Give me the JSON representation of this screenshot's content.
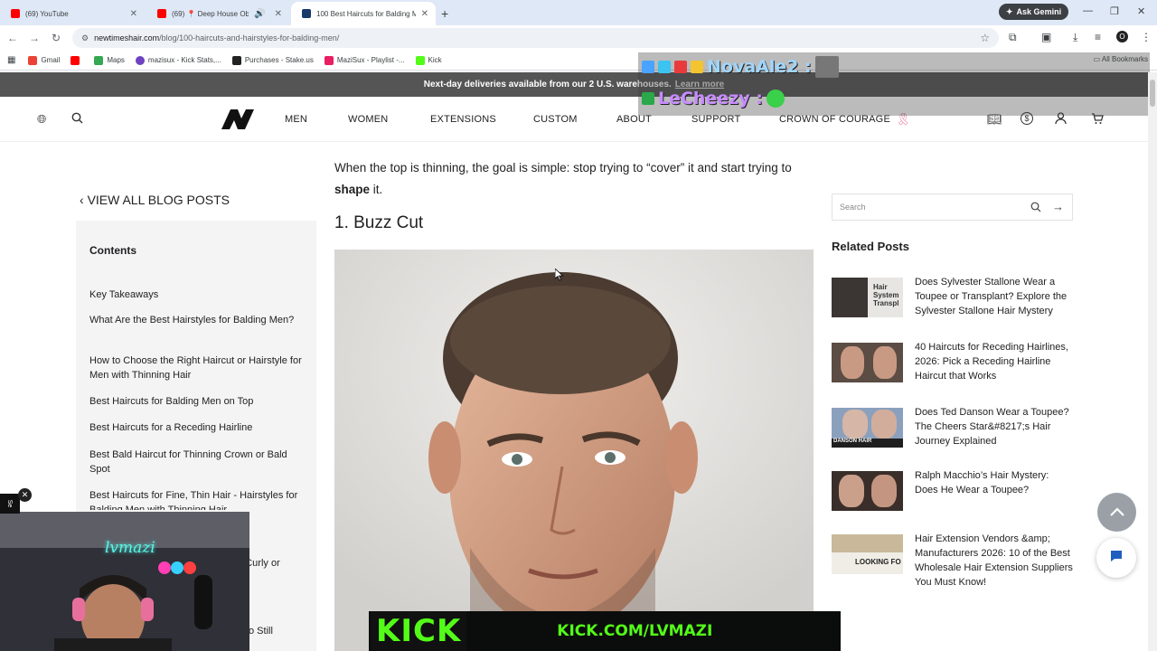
{
  "browser": {
    "tabs": [
      {
        "title": "(69) YouTube",
        "color": "#ff0000"
      },
      {
        "title": "(69) 📍 Deep House Obse",
        "color": "#ff0000"
      },
      {
        "title": "100 Best Haircuts for Balding M",
        "color": "#1a3a6b"
      }
    ],
    "new_tab": "+",
    "gemini_label": "Ask Gemini",
    "url_host": "newtimeshair.com",
    "url_path": "/blog/100-haircuts-and-hairstyles-for-balding-men/",
    "bookmarks": [
      {
        "label": "Gmail",
        "color": "#ea4335"
      },
      {
        "label": "Maps",
        "color": "#34a853"
      },
      {
        "label": "mazisux - Kick Stats,...",
        "color": "#6f42c1"
      },
      {
        "label": "Purchases - Stake.us",
        "color": "#222222"
      },
      {
        "label": "MaziSux - Playlist -...",
        "color": "#e91e63"
      },
      {
        "label": "Kick",
        "color": "#53fc18"
      }
    ],
    "all_bookmarks": "All Bookmarks"
  },
  "promo": {
    "text": "Next-day deliveries available from our 2 U.S. warehouses.",
    "link": "Learn more"
  },
  "site_nav": {
    "items": [
      "MEN",
      "WOMEN",
      "EXTENSIONS",
      "CUSTOM",
      "ABOUT",
      "SUPPORT",
      "CROWN OF COURAGE"
    ]
  },
  "stream_overlay": {
    "name1": "NovaAle2 :",
    "name2": "LeCheezy :",
    "name1_color": "#9fd6ff",
    "name2_color": "#c68bff"
  },
  "sidebar": {
    "back_link": "VIEW ALL BLOG POSTS",
    "contents_title": "Contents",
    "toc": [
      "Key Takeaways",
      "What Are the Best Hairstyles for Balding Men?",
      "How to Choose the Right Haircut or Hairstyle for Men with Thinning Hair",
      "Best Haircuts for Balding Men on Top",
      "Best Haircuts for a Receding Hairline",
      "Best Bald Haircut for Thinning Crown or Bald Spot",
      "Best Haircuts for Fine, Thin Hair - Hairstyles for Balding Men with Thinning Hair"
    ],
    "toc_partial_1": "th Curly or",
    "toc_partial_2": "o Still"
  },
  "article": {
    "intro_before": "When the top is thinning, the goal is simple: stop trying to “cover” it and start trying to",
    "intro_bold": "shape",
    "intro_after": "it.",
    "heading": "1. Buzz Cut"
  },
  "right": {
    "search_placeholder": "Search",
    "related_title": "Related Posts",
    "posts": [
      {
        "title": "Does Sylvester Stallone Wear a Toupee or Transplant? Explore the Sylvester Stallone Hair Mystery",
        "thumb_text": "Hair System Transpl"
      },
      {
        "title": "40 Haircuts for Receding Hairlines, 2026: Pick a Receding Hairline Haircut that Works",
        "thumb_text": ""
      },
      {
        "title": "Does Ted Danson Wear a Toupee? The Cheers Star&#8217;s Hair Journey Explained",
        "thumb_text": "DANSON HAIR"
      },
      {
        "title": "Ralph Macchio’s Hair Mystery: Does He Wear a Toupee?",
        "thumb_text": ""
      },
      {
        "title": "Hair Extension Vendors &amp; Manufacturers 2026: 10 of the Best Wholesale Hair Extension Suppliers You Must Know!",
        "thumb_text": "LOOKING FO"
      }
    ]
  },
  "stream": {
    "kick_logo": "KICK",
    "kick_url": "KICK.COM/LVMAZI",
    "neon_sign": "lvmazi",
    "side_tab": "Se"
  }
}
